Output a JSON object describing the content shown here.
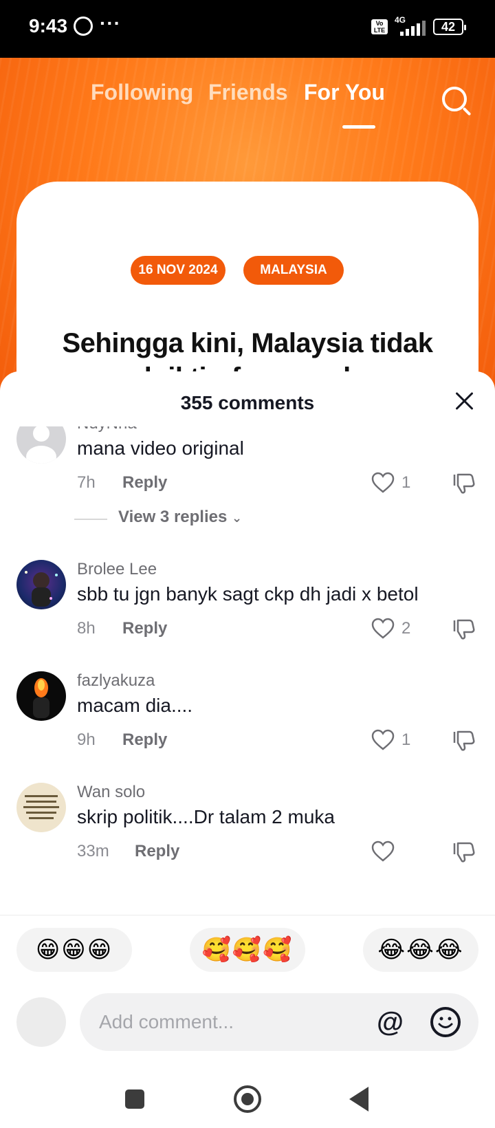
{
  "status_bar": {
    "time": "9:43",
    "overflow": "···",
    "volte": "Vo LTE",
    "network": "4G",
    "battery": "42"
  },
  "top_nav": {
    "tabs": [
      {
        "label": "Following",
        "active": false
      },
      {
        "label": "Friends",
        "active": false
      },
      {
        "label": "For You",
        "active": true
      }
    ]
  },
  "video_card": {
    "date_chip": "16 NOV 2024",
    "country_chip": "MALAYSIA",
    "headline": "Sehingga kini, Malaysia tidak pernah iktiraf negara haram Israel - Fahmi"
  },
  "comments_sheet": {
    "title": "355 comments",
    "reply_label": "Reply",
    "comments": [
      {
        "username": "NdyNna",
        "text": "mana video original",
        "time": "7h",
        "likes": "1",
        "view_replies": "View 3 replies"
      },
      {
        "username": "Brolee Lee",
        "text": "sbb tu jgn banyk sagt ckp dh jadi x betol",
        "time": "8h",
        "likes": "2"
      },
      {
        "username": "fazlyakuza",
        "text": "macam dia....",
        "time": "9h",
        "likes": "1"
      },
      {
        "username": "Wan solo",
        "text": "skrip politik....Dr talam 2 muka",
        "time": "33m",
        "likes": ""
      }
    ]
  },
  "emoji_bar": {
    "pills": [
      "😁😁😁",
      "🥰🥰🥰",
      "😂😂😂"
    ]
  },
  "composer": {
    "placeholder": "Add comment...",
    "at_label": "@"
  },
  "colors": {
    "accent": "#f25a0a",
    "text_primary": "#161823"
  }
}
